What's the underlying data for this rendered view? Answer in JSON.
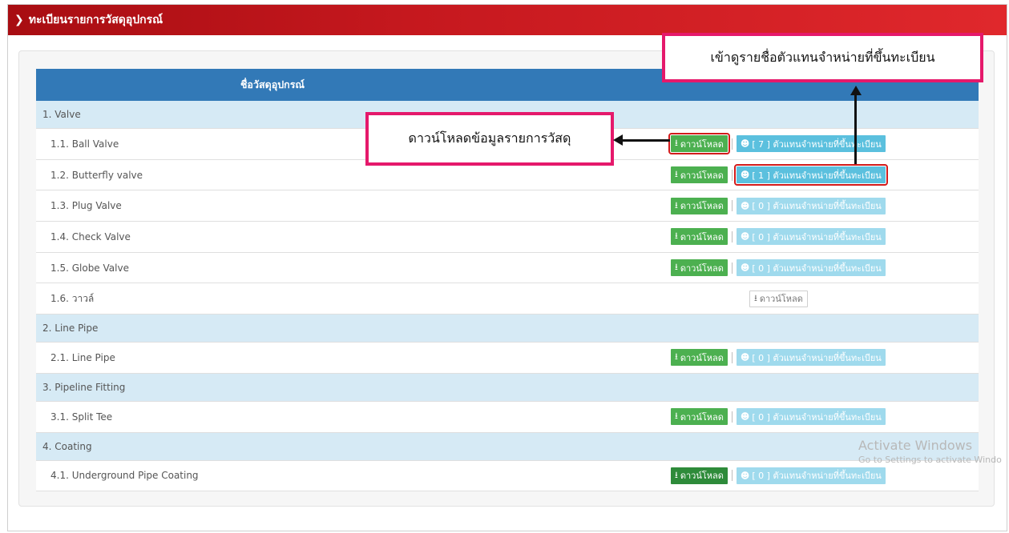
{
  "header": {
    "title": "ทะเบียนรายการวัสดุอุปกรณ์"
  },
  "table": {
    "column_name": "ชื่อวัสดุอุปกรณ์",
    "rows": [
      {
        "type": "group",
        "label": "1. Valve"
      },
      {
        "type": "item",
        "label": "1.1. Ball Valve",
        "download": "ดาวน์โหลด",
        "agents": "[ 7 ] ตัวแทนจำหน่ายที่ขึ้นทะเบียน",
        "download_highlight": true
      },
      {
        "type": "item",
        "label": "1.2. Butterfly valve",
        "download": "ดาวน์โหลด",
        "agents": "[ 1 ] ตัวแทนจำหน่ายที่ขึ้นทะเบียน",
        "agents_highlight": true
      },
      {
        "type": "item",
        "label": "1.3. Plug Valve",
        "download": "ดาวน์โหลด",
        "agents": "[ 0 ] ตัวแทนจำหน่ายที่ขึ้นทะเบียน"
      },
      {
        "type": "item",
        "label": "1.4. Check Valve",
        "download": "ดาวน์โหลด",
        "agents": "[ 0 ] ตัวแทนจำหน่ายที่ขึ้นทะเบียน"
      },
      {
        "type": "item",
        "label": "1.5. Globe Valve",
        "download": "ดาวน์โหลด",
        "agents": "[ 0 ] ตัวแทนจำหน่ายที่ขึ้นทะเบียน"
      },
      {
        "type": "item",
        "label": "1.6. วาวล์",
        "download": "ดาวน์โหลด",
        "download_style": "grey"
      },
      {
        "type": "group",
        "label": "2. Line Pipe"
      },
      {
        "type": "item",
        "label": "2.1. Line Pipe",
        "download": "ดาวน์โหลด",
        "agents": "[ 0 ] ตัวแทนจำหน่ายที่ขึ้นทะเบียน"
      },
      {
        "type": "group",
        "label": "3. Pipeline Fitting"
      },
      {
        "type": "item",
        "label": "3.1. Split Tee",
        "download": "ดาวน์โหลด",
        "agents": "[ 0 ] ตัวแทนจำหน่ายที่ขึ้นทะเบียน"
      },
      {
        "type": "group",
        "label": "4. Coating"
      },
      {
        "type": "item",
        "label": "4.1. Underground Pipe Coating",
        "download": "ดาวน์โหลด",
        "agents": "[ 0 ] ตัวแทนจำหน่ายที่ขึ้นทะเบียน",
        "download_style": "dark"
      }
    ]
  },
  "callouts": {
    "download": "ดาวน์โหลดข้อมูลรายการวัสดุ",
    "agents": "เข้าดูรายชื่อตัวแทนจำหน่ายที่ขึ้นทะเบียน"
  },
  "watermark": {
    "line1": "Activate Windows",
    "line2": "Go to Settings to activate Windo"
  },
  "colors": {
    "header": "#c5181e",
    "table_head": "#3279b7",
    "group_row": "#d6eaf5",
    "download_button": "#4cb050",
    "agents_button": "#5bc0de",
    "callout_border": "#e5196b"
  },
  "icons": {
    "header": "chevron-right-icon",
    "download": "download-icon",
    "agents": "users-icon"
  }
}
